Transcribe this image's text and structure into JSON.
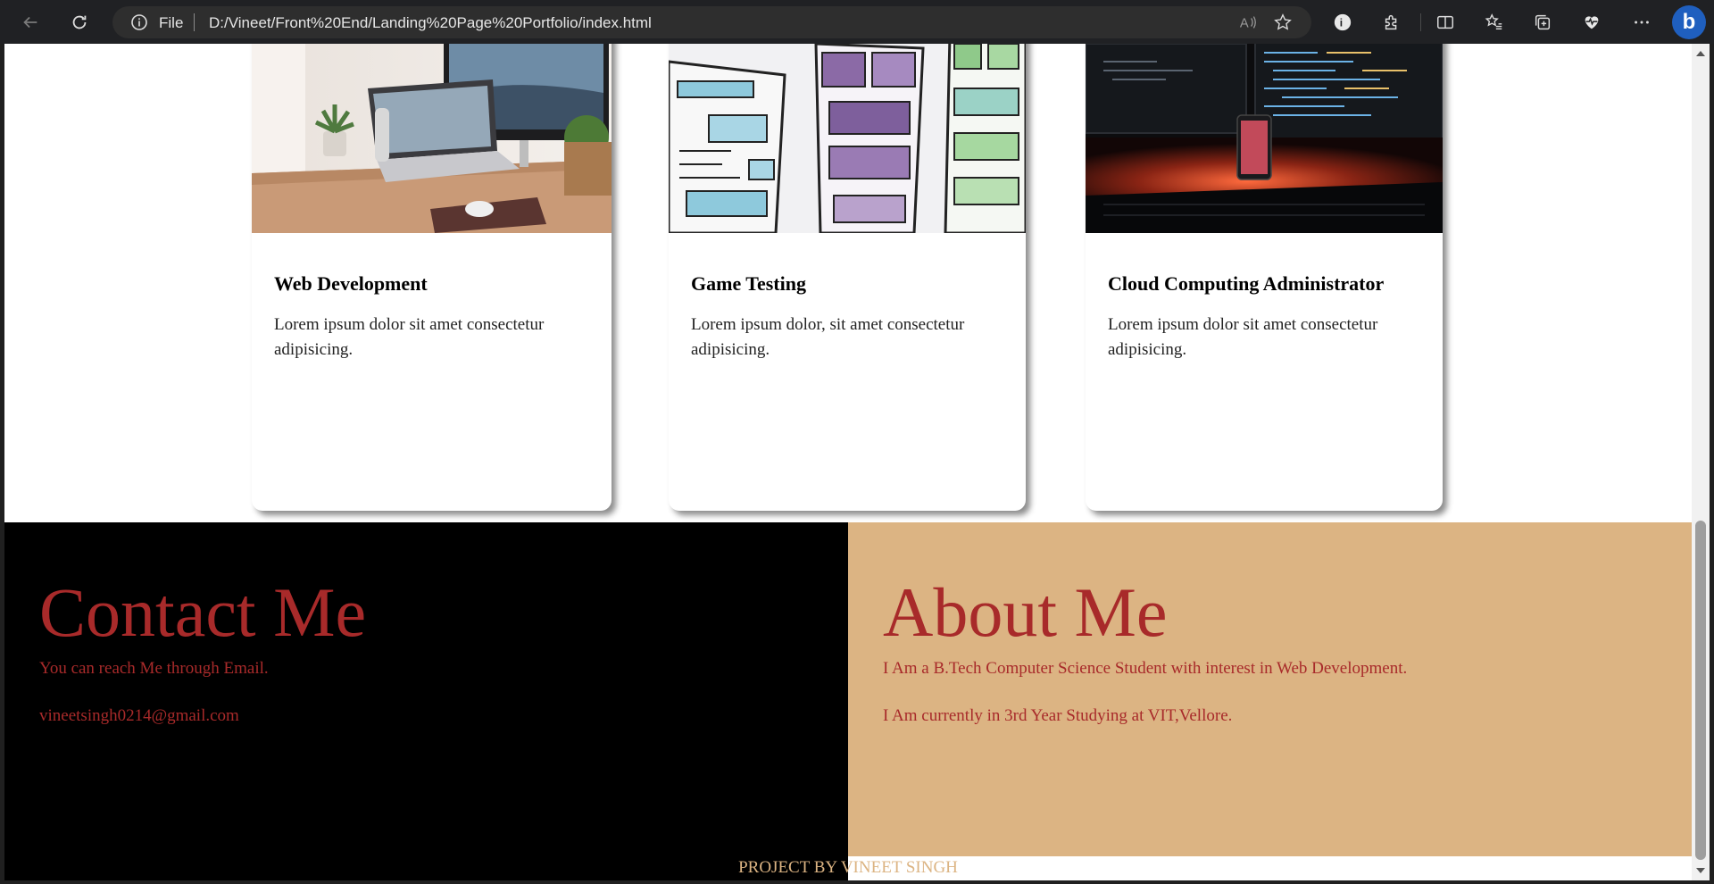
{
  "browser": {
    "address_scheme": "File",
    "address_url": "D:/Vineet/Front%20End/Landing%20Page%20Portfolio/index.html",
    "icons": {
      "back": "back-arrow-icon",
      "refresh": "refresh-icon",
      "info": "info-icon",
      "read_aloud": "read-aloud-icon",
      "favorite": "star-icon",
      "extension_badge": "extension-badge-icon",
      "extensions": "puzzle-icon",
      "split_screen": "split-screen-icon",
      "favorites": "favorites-list-icon",
      "collections": "collections-icon",
      "browser_essentials": "heart-pulse-icon",
      "more": "more-dots-icon",
      "copilot": "bing-icon"
    },
    "bing_glyph": "b"
  },
  "cards": [
    {
      "title": "Web Development",
      "text": "Lorem ipsum dolor sit amet consectetur adipisicing.",
      "image": "laptop-desk-photo"
    },
    {
      "title": "Game Testing",
      "text": "Lorem ipsum dolor, sit amet consectetur adipisicing.",
      "image": "wireframe-sketch-photo"
    },
    {
      "title": "Cloud Computing Administrator",
      "text": "Lorem ipsum dolor sit amet consectetur adipisicing.",
      "image": "dark-code-monitors-photo"
    }
  ],
  "contact": {
    "title": "Contact Me",
    "line1": "You can reach Me through Email.",
    "email": "vineetsingh0214@gmail.com"
  },
  "about": {
    "title": "About Me",
    "line1": "I Am a B.Tech Computer Science Student with interest in Web Development.",
    "line2": "I Am currently in 3rd Year Studying at VIT,Vellore."
  },
  "footer": {
    "credit": "PROJECT BY VINEET SINGH"
  },
  "colors": {
    "accent_red": "#a82a2a",
    "tan": "#dcb483",
    "black": "#000000",
    "chrome": "#202124"
  }
}
